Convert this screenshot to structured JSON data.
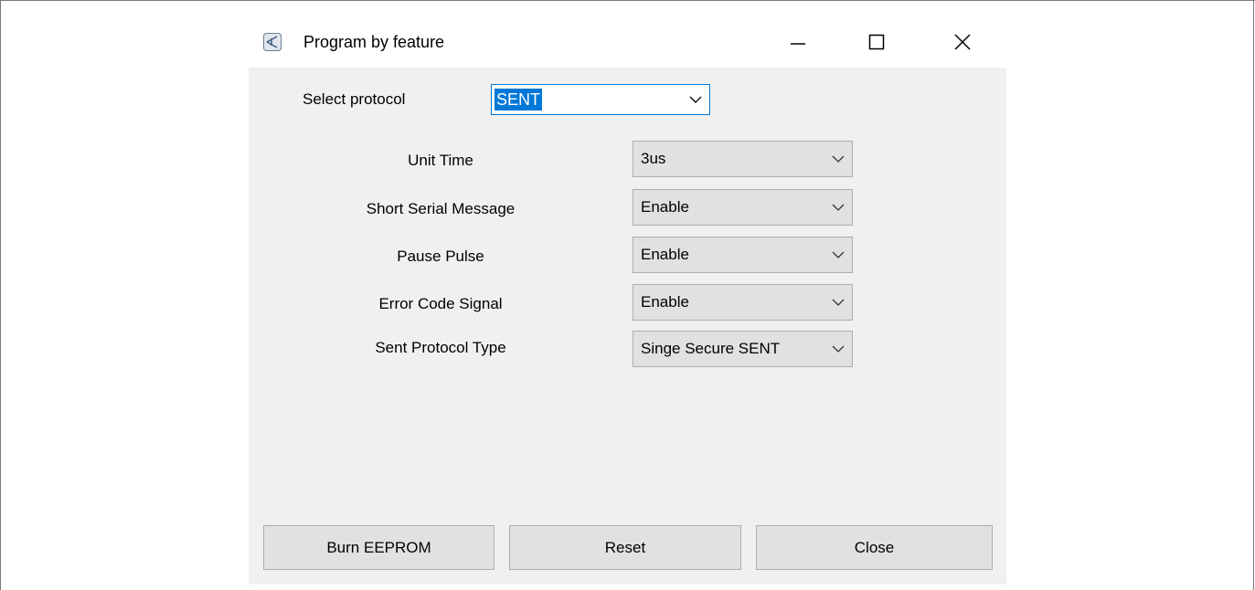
{
  "window": {
    "title": "Program by feature",
    "icon": "app-window-icon",
    "controls": {
      "minimize_icon": "minimize-icon",
      "maximize_icon": "maximize-icon",
      "close_icon": "close-icon"
    }
  },
  "protocol": {
    "label": "Select protocol",
    "value": "SENT"
  },
  "settings": [
    {
      "label": "Unit Time",
      "value": "3us"
    },
    {
      "label": "Short Serial Message",
      "value": "Enable"
    },
    {
      "label": "Pause Pulse",
      "value": "Enable"
    },
    {
      "label": "Error Code Signal",
      "value": "Enable"
    },
    {
      "label": "Sent Protocol Type",
      "value": "Singe Secure SENT"
    }
  ],
  "buttons": {
    "burn": "Burn EEPROM",
    "reset": "Reset",
    "close": "Close"
  },
  "colors": {
    "accent": "#0078d7",
    "panel": "#f0f0f0",
    "control": "#e1e1e1"
  }
}
